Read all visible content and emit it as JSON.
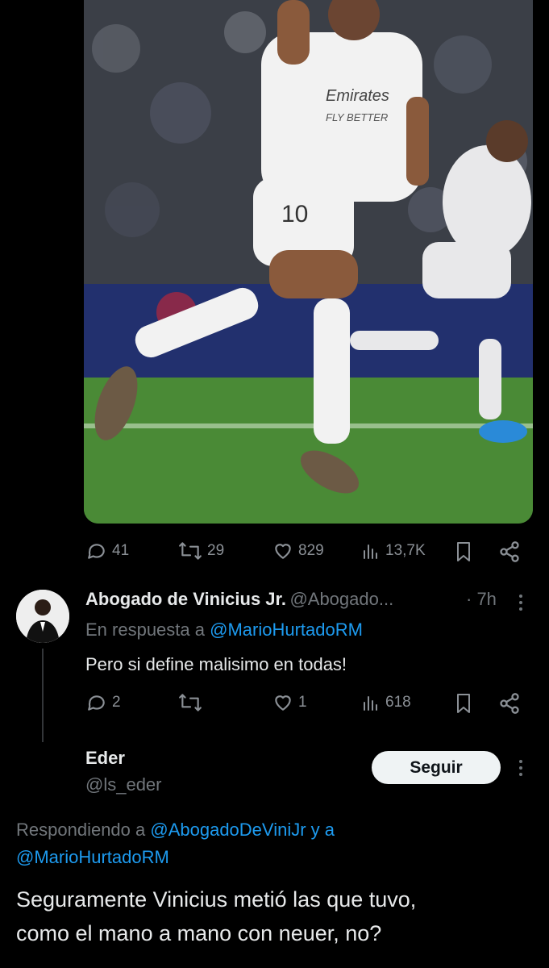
{
  "tweet": {
    "media_alt": "footballer-celebrating-photo",
    "actions": {
      "replies": "41",
      "retweets": "29",
      "likes": "829",
      "views": "13,7K"
    }
  },
  "reply1": {
    "name": "Abogado de Vinicius Jr.",
    "handle": "@Abogado...",
    "time": "· 7h",
    "in_reply_prefix": "En respuesta a",
    "in_reply_handle": "@MarioHurtadoRM",
    "text": "Pero si define malisimo en todas!",
    "actions": {
      "replies": "2",
      "retweets": "",
      "likes": "1",
      "views": "618"
    }
  },
  "reply2": {
    "name": "Eder",
    "handle": "@ls_eder",
    "follow_label": "Seguir",
    "replying_prefix": "Respondiendo a",
    "replying_handle1": "@AbogadoDeViniJr",
    "replying_and": "y a",
    "replying_handle2": "@MarioHurtadoRM",
    "text_line1": "Seguramente Vinicius metió las que tuvo,",
    "text_line2": "como el mano a mano con neuer, no?"
  },
  "colors": {
    "background": "#000000",
    "link": "#1d9bf0",
    "muted": "#71767b",
    "text": "#e7e9ea",
    "button_bg": "#eff3f4"
  }
}
